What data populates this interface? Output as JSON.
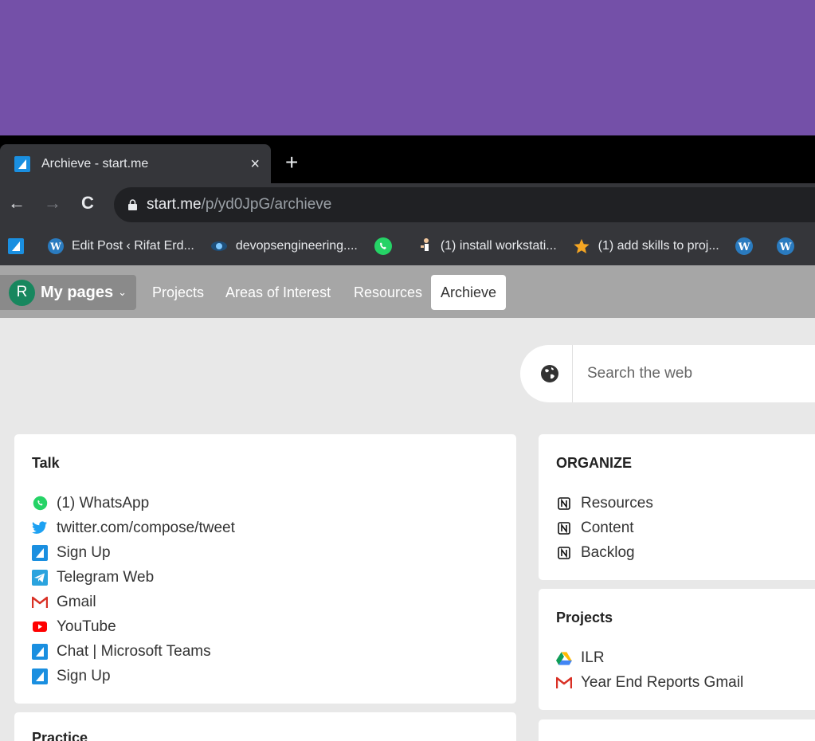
{
  "browser": {
    "tab": {
      "title": "Archieve - start.me",
      "close": "×"
    },
    "new_tab": "+",
    "url_host": "start.me",
    "url_path": "/p/yd0JpG/archieve",
    "nav": {
      "back": "←",
      "forward": "→",
      "reload": "C"
    },
    "bookmarks": [
      {
        "label": "",
        "icon": "startme-icon"
      },
      {
        "label": "Edit Post ‹ Rifat Erd...",
        "icon": "wordpress-icon"
      },
      {
        "label": "devopsengineering....",
        "icon": "devops-icon"
      },
      {
        "label": "",
        "icon": "whatsapp-icon"
      },
      {
        "label": "(1) install workstati...",
        "icon": "figure-icon"
      },
      {
        "label": "(1) add skills to proj...",
        "icon": "star-icon"
      },
      {
        "label": "",
        "icon": "wordpress-icon"
      },
      {
        "label": "",
        "icon": "wordpress-icon"
      }
    ]
  },
  "nav": {
    "avatar_letter": "R",
    "my_pages": "My pages",
    "chevron": "⌄",
    "tabs": [
      "Projects",
      "Areas of Interest",
      "Resources",
      "Archieve"
    ],
    "active_tab": "Archieve"
  },
  "search": {
    "placeholder": "Search the web"
  },
  "cards": [
    {
      "title": "Talk",
      "links": [
        {
          "label": "(1) WhatsApp",
          "icon": "whatsapp-icon"
        },
        {
          "label": "twitter.com/compose/tweet",
          "icon": "twitter-icon"
        },
        {
          "label": "Sign Up",
          "icon": "startme-icon"
        },
        {
          "label": "Telegram Web",
          "icon": "telegram-icon"
        },
        {
          "label": "Gmail",
          "icon": "gmail-icon"
        },
        {
          "label": "YouTube",
          "icon": "youtube-icon"
        },
        {
          "label": "Chat | Microsoft Teams",
          "icon": "startme-icon"
        },
        {
          "label": "Sign Up",
          "icon": "startme-icon"
        }
      ]
    },
    {
      "title": "ORGANIZE",
      "links": [
        {
          "label": "Resources",
          "icon": "notion-icon"
        },
        {
          "label": "Content",
          "icon": "notion-icon"
        },
        {
          "label": "Backlog",
          "icon": "notion-icon"
        }
      ]
    },
    {
      "title": "Projects",
      "links": [
        {
          "label": "ILR",
          "icon": "google-drive-icon"
        },
        {
          "label": "Year End Reports Gmail",
          "icon": "gmail-icon"
        }
      ]
    },
    {
      "title": "Practice",
      "links": []
    }
  ],
  "colors": {
    "brand_purple": "#7450a8",
    "avatar_green": "#17875e",
    "page_bg": "#e8e8e8"
  }
}
